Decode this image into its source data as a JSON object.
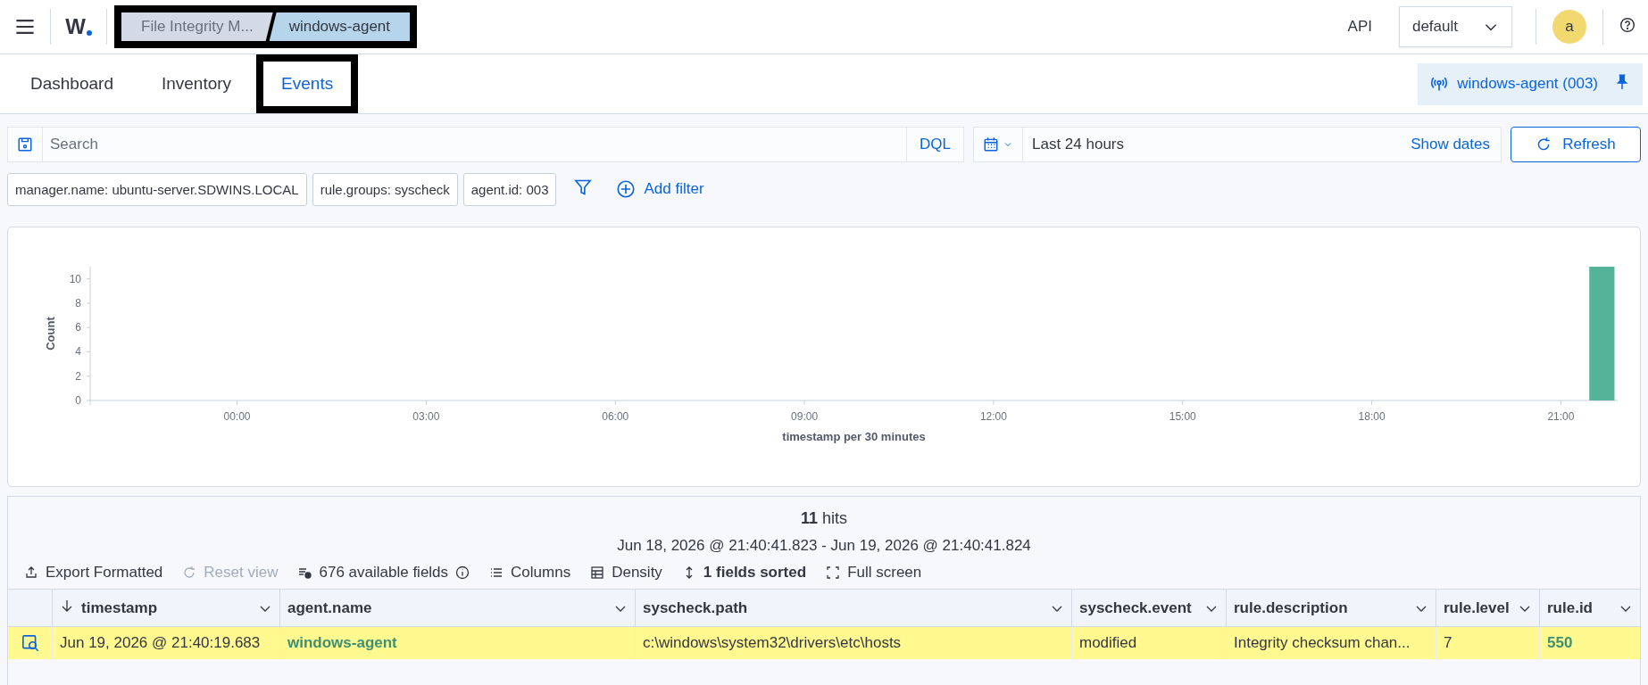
{
  "header": {
    "logo": "W",
    "breadcrumbs": [
      {
        "label": "File Integrity M...",
        "selected": false
      },
      {
        "label": "windows-agent",
        "selected": true
      }
    ],
    "breadcrumbs_boxed": true,
    "api_label": "API",
    "space_selector": "default",
    "avatar": "a"
  },
  "tabs": [
    {
      "label": "Dashboard",
      "selected": false,
      "boxed": false
    },
    {
      "label": "Inventory",
      "selected": false,
      "boxed": false
    },
    {
      "label": "Events",
      "selected": true,
      "boxed": true
    }
  ],
  "pinned_agent": "windows-agent (003)",
  "query_bar": {
    "placeholder": "Search",
    "language": "DQL",
    "time_range": "Last 24 hours",
    "show_dates": "Show dates",
    "refresh": "Refresh"
  },
  "filters": [
    "manager.name: ubuntu-server.SDWINS.LOCAL",
    "rule.groups: syscheck",
    "agent.id: 003"
  ],
  "add_filter": "Add filter",
  "chart": {
    "chart_data": {
      "type": "bar",
      "xlabel": "timestamp per 30 minutes",
      "ylabel": "Count",
      "x": [
        21.65
      ],
      "values": [
        11
      ],
      "xlim": [
        -2.33,
        21.9
      ],
      "ylim": [
        0,
        11
      ],
      "xticks": [
        {
          "value": 0,
          "label": "00:00"
        },
        {
          "value": 3,
          "label": "03:00"
        },
        {
          "value": 6,
          "label": "06:00"
        },
        {
          "value": 9,
          "label": "09:00"
        },
        {
          "value": 12,
          "label": "12:00"
        },
        {
          "value": 15,
          "label": "15:00"
        },
        {
          "value": 18,
          "label": "18:00"
        },
        {
          "value": 21,
          "label": "21:00"
        }
      ],
      "yticks": [
        0,
        2,
        4,
        6,
        8,
        10
      ]
    }
  },
  "results": {
    "hits_count": "11",
    "hits_label": "hits",
    "range": "Jun 18, 2026 @ 21:40:41.823 - Jun 19, 2026 @ 21:40:41.824",
    "toolbar": [
      {
        "kind": "export",
        "label": "Export Formatted",
        "disabled": false
      },
      {
        "kind": "reset",
        "label": "Reset view",
        "disabled": true
      },
      {
        "kind": "fields",
        "label": "676 available fields",
        "disabled": false
      },
      {
        "kind": "columns",
        "label": "Columns",
        "disabled": false
      },
      {
        "kind": "density",
        "label": "Density",
        "disabled": false
      },
      {
        "kind": "sort",
        "label": "1 fields sorted",
        "disabled": false
      },
      {
        "kind": "fullscreen",
        "label": "Full screen",
        "disabled": false
      }
    ],
    "columns": [
      {
        "label": "timestamp",
        "sorted": true
      },
      {
        "label": "agent.name",
        "sorted": false
      },
      {
        "label": "syscheck.path",
        "sorted": false
      },
      {
        "label": "syscheck.event",
        "sorted": false
      },
      {
        "label": "rule.description",
        "sorted": false
      },
      {
        "label": "rule.level",
        "sorted": false
      },
      {
        "label": "rule.id",
        "sorted": false
      }
    ],
    "rows": [
      {
        "highlighted": true,
        "cells": [
          {
            "kind": "text",
            "text": "Jun 19, 2026 @ 21:40:19.683"
          },
          {
            "kind": "link",
            "text": "windows-agent"
          },
          {
            "kind": "text",
            "text": "c:\\windows\\system32\\drivers\\etc\\hosts"
          },
          {
            "kind": "text",
            "text": "modified"
          },
          {
            "kind": "text",
            "text": "Integrity checksum chan..."
          },
          {
            "kind": "text",
            "text": "7"
          },
          {
            "kind": "link",
            "text": "550"
          }
        ]
      }
    ]
  }
}
